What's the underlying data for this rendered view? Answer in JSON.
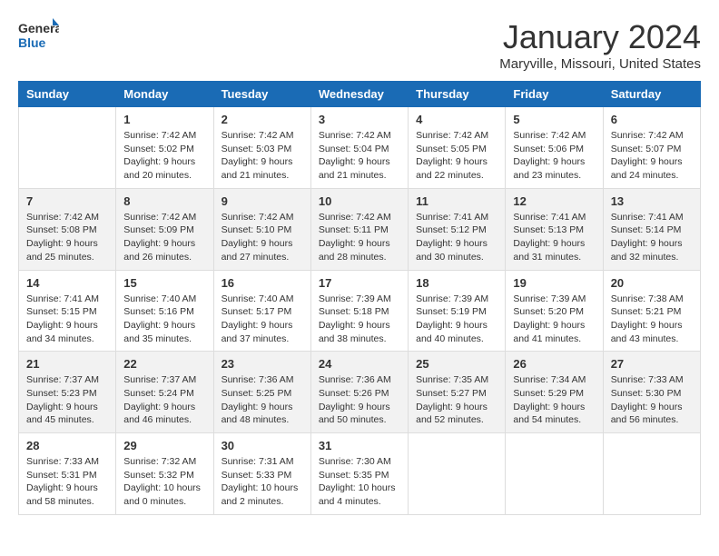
{
  "header": {
    "logo_line1": "General",
    "logo_line2": "Blue",
    "month": "January 2024",
    "location": "Maryville, Missouri, United States"
  },
  "days_of_week": [
    "Sunday",
    "Monday",
    "Tuesday",
    "Wednesday",
    "Thursday",
    "Friday",
    "Saturday"
  ],
  "weeks": [
    [
      {
        "day": "",
        "info": ""
      },
      {
        "day": "1",
        "info": "Sunrise: 7:42 AM\nSunset: 5:02 PM\nDaylight: 9 hours\nand 20 minutes."
      },
      {
        "day": "2",
        "info": "Sunrise: 7:42 AM\nSunset: 5:03 PM\nDaylight: 9 hours\nand 21 minutes."
      },
      {
        "day": "3",
        "info": "Sunrise: 7:42 AM\nSunset: 5:04 PM\nDaylight: 9 hours\nand 21 minutes."
      },
      {
        "day": "4",
        "info": "Sunrise: 7:42 AM\nSunset: 5:05 PM\nDaylight: 9 hours\nand 22 minutes."
      },
      {
        "day": "5",
        "info": "Sunrise: 7:42 AM\nSunset: 5:06 PM\nDaylight: 9 hours\nand 23 minutes."
      },
      {
        "day": "6",
        "info": "Sunrise: 7:42 AM\nSunset: 5:07 PM\nDaylight: 9 hours\nand 24 minutes."
      }
    ],
    [
      {
        "day": "7",
        "info": "Sunrise: 7:42 AM\nSunset: 5:08 PM\nDaylight: 9 hours\nand 25 minutes."
      },
      {
        "day": "8",
        "info": "Sunrise: 7:42 AM\nSunset: 5:09 PM\nDaylight: 9 hours\nand 26 minutes."
      },
      {
        "day": "9",
        "info": "Sunrise: 7:42 AM\nSunset: 5:10 PM\nDaylight: 9 hours\nand 27 minutes."
      },
      {
        "day": "10",
        "info": "Sunrise: 7:42 AM\nSunset: 5:11 PM\nDaylight: 9 hours\nand 28 minutes."
      },
      {
        "day": "11",
        "info": "Sunrise: 7:41 AM\nSunset: 5:12 PM\nDaylight: 9 hours\nand 30 minutes."
      },
      {
        "day": "12",
        "info": "Sunrise: 7:41 AM\nSunset: 5:13 PM\nDaylight: 9 hours\nand 31 minutes."
      },
      {
        "day": "13",
        "info": "Sunrise: 7:41 AM\nSunset: 5:14 PM\nDaylight: 9 hours\nand 32 minutes."
      }
    ],
    [
      {
        "day": "14",
        "info": "Sunrise: 7:41 AM\nSunset: 5:15 PM\nDaylight: 9 hours\nand 34 minutes."
      },
      {
        "day": "15",
        "info": "Sunrise: 7:40 AM\nSunset: 5:16 PM\nDaylight: 9 hours\nand 35 minutes."
      },
      {
        "day": "16",
        "info": "Sunrise: 7:40 AM\nSunset: 5:17 PM\nDaylight: 9 hours\nand 37 minutes."
      },
      {
        "day": "17",
        "info": "Sunrise: 7:39 AM\nSunset: 5:18 PM\nDaylight: 9 hours\nand 38 minutes."
      },
      {
        "day": "18",
        "info": "Sunrise: 7:39 AM\nSunset: 5:19 PM\nDaylight: 9 hours\nand 40 minutes."
      },
      {
        "day": "19",
        "info": "Sunrise: 7:39 AM\nSunset: 5:20 PM\nDaylight: 9 hours\nand 41 minutes."
      },
      {
        "day": "20",
        "info": "Sunrise: 7:38 AM\nSunset: 5:21 PM\nDaylight: 9 hours\nand 43 minutes."
      }
    ],
    [
      {
        "day": "21",
        "info": "Sunrise: 7:37 AM\nSunset: 5:23 PM\nDaylight: 9 hours\nand 45 minutes."
      },
      {
        "day": "22",
        "info": "Sunrise: 7:37 AM\nSunset: 5:24 PM\nDaylight: 9 hours\nand 46 minutes."
      },
      {
        "day": "23",
        "info": "Sunrise: 7:36 AM\nSunset: 5:25 PM\nDaylight: 9 hours\nand 48 minutes."
      },
      {
        "day": "24",
        "info": "Sunrise: 7:36 AM\nSunset: 5:26 PM\nDaylight: 9 hours\nand 50 minutes."
      },
      {
        "day": "25",
        "info": "Sunrise: 7:35 AM\nSunset: 5:27 PM\nDaylight: 9 hours\nand 52 minutes."
      },
      {
        "day": "26",
        "info": "Sunrise: 7:34 AM\nSunset: 5:29 PM\nDaylight: 9 hours\nand 54 minutes."
      },
      {
        "day": "27",
        "info": "Sunrise: 7:33 AM\nSunset: 5:30 PM\nDaylight: 9 hours\nand 56 minutes."
      }
    ],
    [
      {
        "day": "28",
        "info": "Sunrise: 7:33 AM\nSunset: 5:31 PM\nDaylight: 9 hours\nand 58 minutes."
      },
      {
        "day": "29",
        "info": "Sunrise: 7:32 AM\nSunset: 5:32 PM\nDaylight: 10 hours\nand 0 minutes."
      },
      {
        "day": "30",
        "info": "Sunrise: 7:31 AM\nSunset: 5:33 PM\nDaylight: 10 hours\nand 2 minutes."
      },
      {
        "day": "31",
        "info": "Sunrise: 7:30 AM\nSunset: 5:35 PM\nDaylight: 10 hours\nand 4 minutes."
      },
      {
        "day": "",
        "info": ""
      },
      {
        "day": "",
        "info": ""
      },
      {
        "day": "",
        "info": ""
      }
    ]
  ]
}
